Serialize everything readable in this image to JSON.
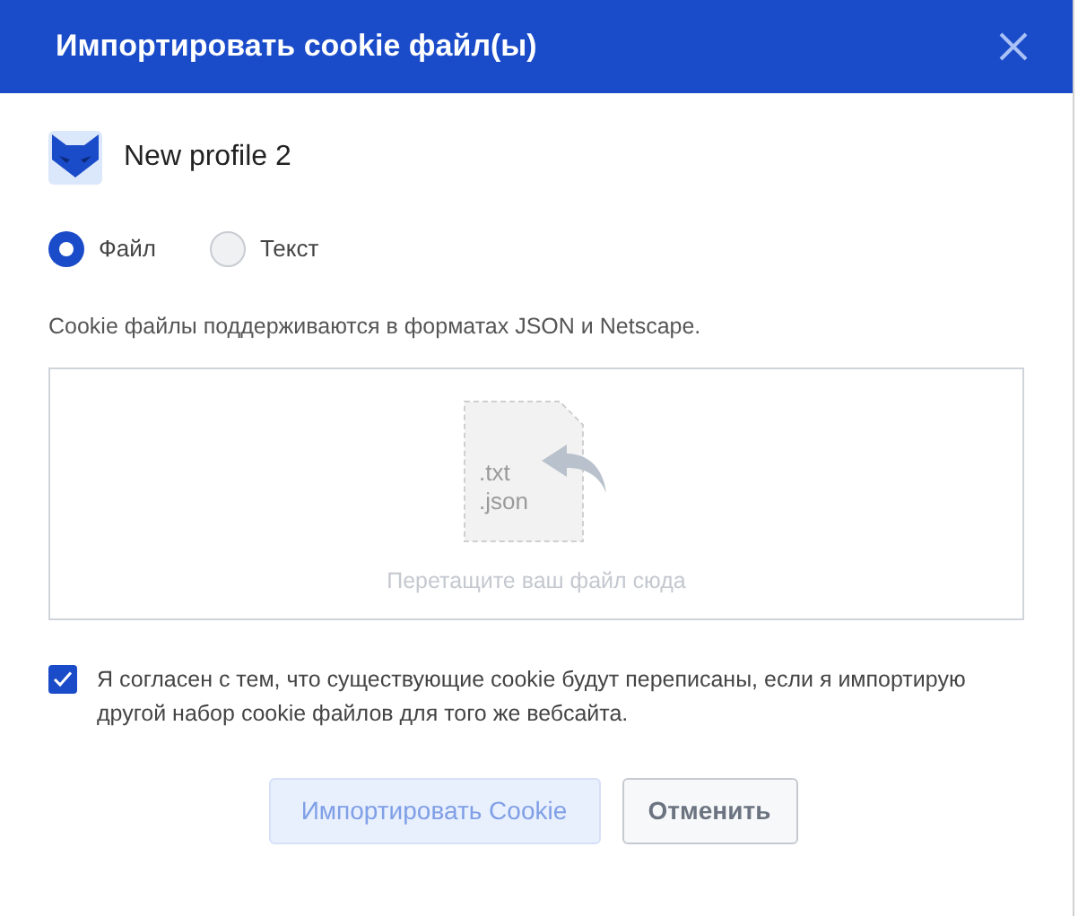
{
  "dialog": {
    "title": "Импортировать cookie файл(ы)"
  },
  "profile": {
    "name": "New profile 2"
  },
  "source_options": [
    {
      "label": "Файл",
      "selected": true
    },
    {
      "label": "Текст",
      "selected": false
    }
  ],
  "hint": "Cookie файлы поддерживаются в форматах JSON и Netscape.",
  "drop_zone": {
    "extensions": [
      ".txt",
      ".json"
    ],
    "text": "Перетащите ваш файл сюда"
  },
  "agreement": {
    "checked": true,
    "text": "Я согласен с тем, что существующие cookie будут переписаны, если я импортирую другой набор cookie файлов для того же вебсайта."
  },
  "buttons": [
    {
      "label": "Импортировать Cookie",
      "kind": "primary",
      "disabled": true
    },
    {
      "label": "Отменить",
      "kind": "secondary",
      "disabled": false
    }
  ]
}
